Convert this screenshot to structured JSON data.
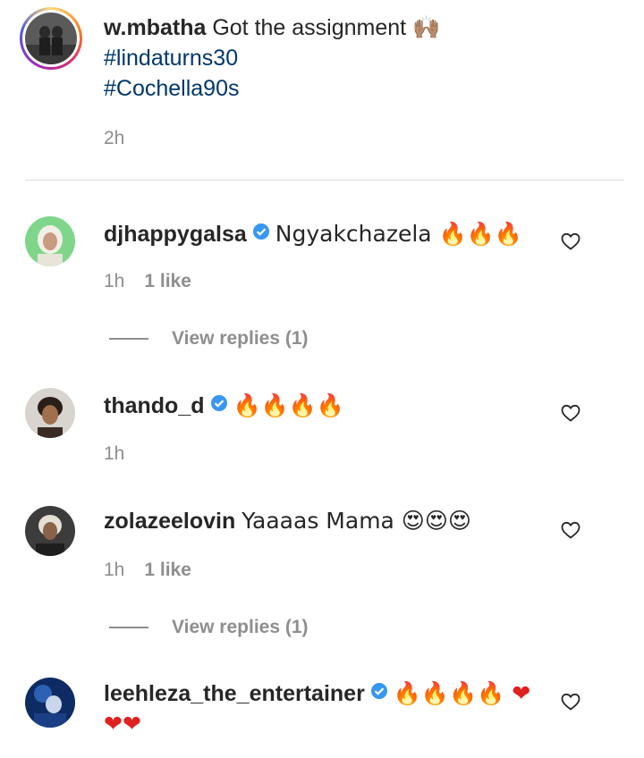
{
  "post": {
    "username": "w.mbatha",
    "caption": "Got the assignment 🙌🏽",
    "hashtags": [
      "#lindaturns30",
      "#Cochella90s"
    ],
    "time": "2h"
  },
  "comments": [
    {
      "username": "djhappygalsa",
      "verified": true,
      "text": "Ngyakchazela 🔥🔥🔥",
      "time": "1h",
      "likes": "1 like",
      "replies": "View replies (1)"
    },
    {
      "username": "thando_d",
      "verified": true,
      "text": "🔥🔥🔥🔥",
      "time": "1h",
      "likes": "",
      "replies": ""
    },
    {
      "username": "zolazeelovin",
      "verified": false,
      "text": "Yaaaas Mama 😍😍😍",
      "time": "1h",
      "likes": "1 like",
      "replies": "View replies (1)"
    },
    {
      "username": "leehleza_the_entertainer",
      "verified": true,
      "text": "🔥🔥🔥🔥 ❤❤❤",
      "time": "",
      "likes": "",
      "replies": ""
    }
  ],
  "colors": {
    "verified": "#3897f0",
    "hashtag": "#00376b",
    "meta": "#8e8e8e"
  },
  "icons": {
    "like": "heart-outline-icon",
    "verified": "verified-badge-icon"
  }
}
